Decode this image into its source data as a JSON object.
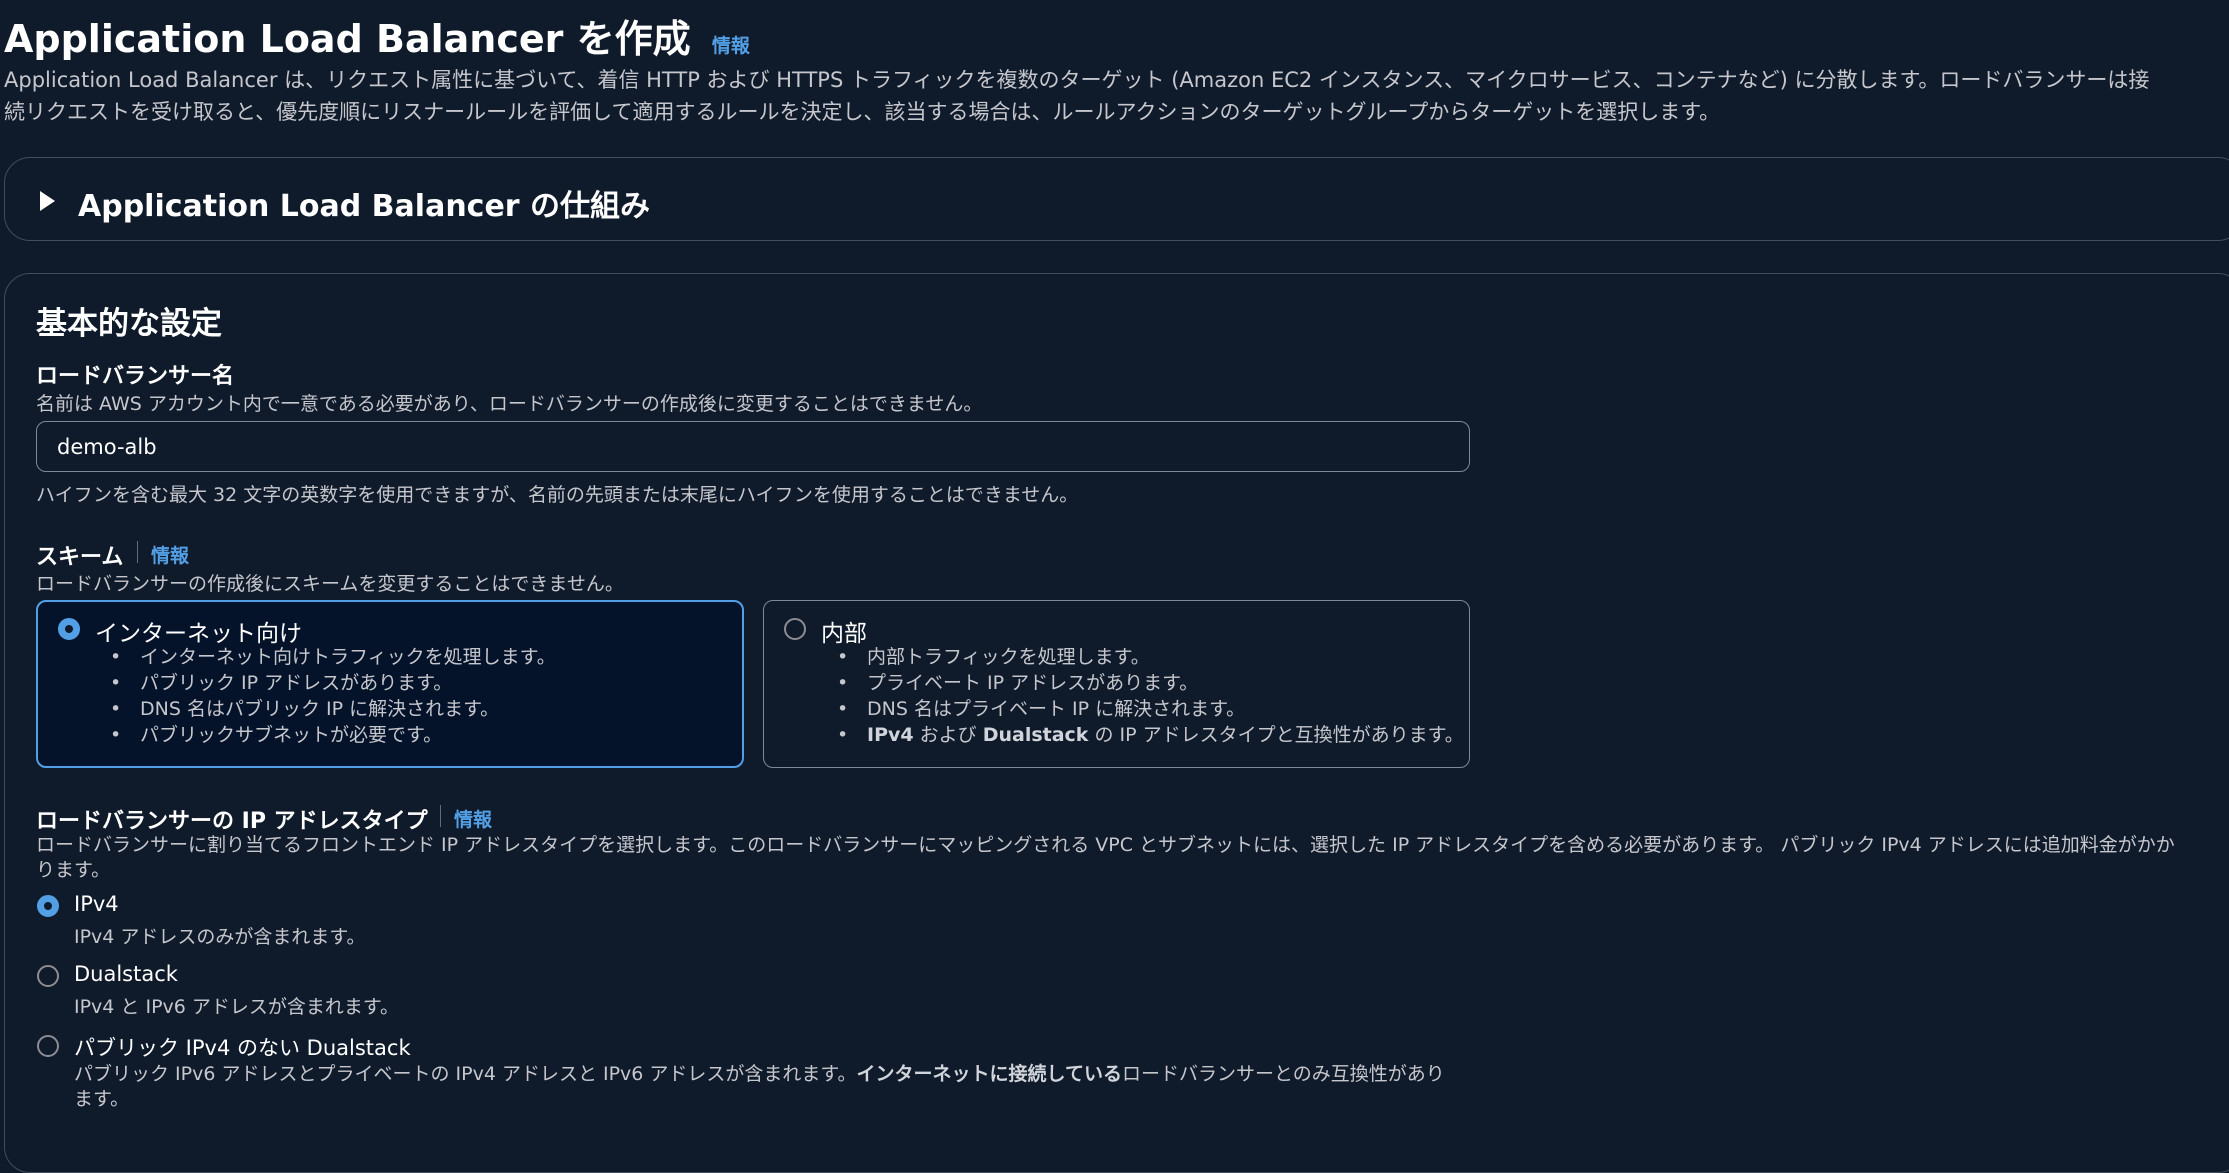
{
  "header": {
    "title": "Application Load Balancer を作成",
    "info": "情報",
    "description_line1": "Application Load Balancer は、リクエスト属性に基づいて、着信 HTTP および HTTPS トラフィックを複数のターゲット (Amazon EC2 インスタンス、マイクロサービス、コンテナなど) に分散します。ロードバランサーは接",
    "description_line2": "続リクエストを受け取ると、優先度順にリスナールールを評価して適用するルールを決定し、該当する場合は、ルールアクションのターゲットグループからターゲットを選択します。"
  },
  "expander": {
    "title": "Application Load Balancer の仕組み"
  },
  "basic": {
    "title": "基本的な設定",
    "name_label": "ロードバランサー名",
    "name_desc": "名前は AWS アカウント内で一意である必要があり、ロードバランサーの作成後に変更することはできません。",
    "name_value": "demo-alb",
    "name_hint": "ハイフンを含む最大 32 文字の英数字を使用できますが、名前の先頭または末尾にハイフンを使用することはできません。",
    "scheme_label": "スキーム",
    "scheme_info": "情報",
    "scheme_desc": "ロードバランサーの作成後にスキームを変更することはできません。",
    "scheme_options": [
      {
        "title": "インターネット向け",
        "bullets": [
          "インターネット向けトラフィックを処理します。",
          "パブリック IP アドレスがあります。",
          "DNS 名はパブリック IP に解決されます。",
          "パブリックサブネットが必要です。"
        ]
      },
      {
        "title": "内部",
        "bullets": [
          "内部トラフィックを処理します。",
          "プライベート IP アドレスがあります。",
          "DNS 名はプライベート IP に解決されます。"
        ],
        "last_bullet_bold1": "IPv4",
        "last_bullet_mid": " および ",
        "last_bullet_bold2": "Dualstack",
        "last_bullet_rest": " の IP アドレスタイプと互換性があります。"
      }
    ],
    "ip_label": "ロードバランサーの IP アドレスタイプ",
    "ip_info": "情報",
    "ip_desc_line1": "ロードバランサーに割り当てるフロントエンド IP アドレスタイプを選択します。このロードバランサーにマッピングされる VPC とサブネットには、選択した IP アドレスタイプを含める必要があります。 パブリック IPv4 アドレスには追加料金がかか",
    "ip_desc_line2": "ります。",
    "ip_options": [
      {
        "label": "IPv4",
        "desc": "IPv4 アドレスのみが含まれます。"
      },
      {
        "label": "Dualstack",
        "desc": "IPv4 と IPv6 アドレスが含まれます。"
      },
      {
        "label": "パブリック IPv4 のない Dualstack",
        "desc_part1": "パブリック IPv6 アドレスとプライベートの IPv4 アドレスと IPv6 アドレスが含まれます。",
        "desc_bold": "インターネットに接続している",
        "desc_part2": "ロードバランサーとのみ互換性があり",
        "desc_line2": "ます。"
      }
    ]
  }
}
